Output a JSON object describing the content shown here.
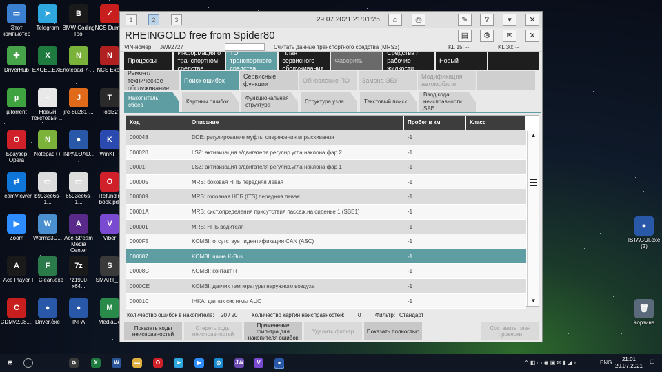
{
  "desktop": {
    "icons": [
      {
        "label": "Этот компьютер",
        "glyph": "▭",
        "color": "#3b7fd0"
      },
      {
        "label": "DriverHub",
        "glyph": "✚",
        "color": "#46a34a"
      },
      {
        "label": "µTorrent",
        "glyph": "µ",
        "color": "#3fa33f"
      },
      {
        "label": "Браузер Opera",
        "glyph": "O",
        "color": "#d0202a"
      },
      {
        "label": "TeamViewer",
        "glyph": "⇄",
        "color": "#0e76d8"
      },
      {
        "label": "Zoom",
        "glyph": "▶",
        "color": "#2d8cff"
      },
      {
        "label": "Ace Player",
        "glyph": "A",
        "color": "#1a1a1a"
      },
      {
        "label": "CDMv2.08....",
        "glyph": "C",
        "color": "#c81e1e"
      },
      {
        "label": "Telegram",
        "glyph": "➤",
        "color": "#2ea6de"
      },
      {
        "label": "EXCEL.EXE",
        "glyph": "X",
        "color": "#1f7a40"
      },
      {
        "label": "Новый текстовый ...",
        "glyph": "≡",
        "color": "#e8e8e8"
      },
      {
        "label": "Notepad++",
        "glyph": "N",
        "color": "#7bb23a"
      },
      {
        "label": "b993ee6s-1...",
        "glyph": "▭",
        "color": "#dcdcdc"
      },
      {
        "label": "Worms3D...",
        "glyph": "W",
        "color": "#4a8fd0"
      },
      {
        "label": "FTClean.exe",
        "glyph": "F",
        "color": "#2a7a4a"
      },
      {
        "label": "Driver.exe",
        "glyph": "●",
        "color": "#2a58a8"
      },
      {
        "label": "BMW Coding Tool",
        "glyph": "B",
        "color": "#1a1a1a"
      },
      {
        "label": "notepad-7-...",
        "glyph": "N",
        "color": "#7bb23a"
      },
      {
        "label": "jre-8u281-...",
        "glyph": "J",
        "color": "#e06a1a"
      },
      {
        "label": "INPALOAD....",
        "glyph": "●",
        "color": "#2a58a8"
      },
      {
        "label": "6593ee6s-1...",
        "glyph": "▭",
        "color": "#dcdcdc"
      },
      {
        "label": "Ace Stream Media Center",
        "glyph": "A",
        "color": "#5a2a8a"
      },
      {
        "label": "7z1900-x64...",
        "glyph": "7z",
        "color": "#1a1a1a"
      },
      {
        "label": "INPA",
        "glyph": "●",
        "color": "#2a58a8"
      },
      {
        "label": "NCS Dumm",
        "glyph": "✓",
        "color": "#c81e1e"
      },
      {
        "label": "NCS Expe",
        "glyph": "N",
        "color": "#b02020"
      },
      {
        "label": "Tool32",
        "glyph": "T",
        "color": "#2a2a2a"
      },
      {
        "label": "WinKFP",
        "glyph": "K",
        "color": "#2a4ab0"
      },
      {
        "label": "Refundin book.pdf",
        "glyph": "O",
        "color": "#d0202a"
      },
      {
        "label": "Viber",
        "glyph": "V",
        "color": "#7a4ad0"
      },
      {
        "label": "SMART_To",
        "glyph": "S",
        "color": "#3a3a3a"
      },
      {
        "label": "MediaGe",
        "glyph": "M",
        "color": "#2a8a4a"
      },
      {
        "label": "ISTAGUI.exe (2)",
        "glyph": "●",
        "color": "#2a58a8"
      },
      {
        "label": "Корзина",
        "glyph": "🗑",
        "color": "#5a6a7a"
      }
    ]
  },
  "app": {
    "topbar": {
      "tabs": [
        "1",
        "2",
        "3"
      ],
      "datetime": "29.07.2021 21:01:25",
      "tools": [
        "home-icon",
        "print-icon",
        "wrench-icon",
        "help-icon",
        "minimize-icon",
        "close-icon"
      ]
    },
    "title": "RHEINGOLD free from Spider80",
    "vin_label": "VIN-номер:",
    "vin_value": "JW92727",
    "vin_status": "Считать данные транспортного средства (MRS3)",
    "kl15": "KL 15:  --",
    "kl30": "KL 30:  --",
    "menu_row1": [
      {
        "label": "Процессы",
        "style": "dark"
      },
      {
        "label": "Информация о транспортном средстве",
        "style": "dark"
      },
      {
        "label": "ТО транспортного средства",
        "style": "teal"
      },
      {
        "label": "План сервисного обслуживания",
        "style": "dark"
      },
      {
        "label": "Фавориты",
        "style": "grey"
      },
      {
        "label": "Средства / рабочие жидкости",
        "style": "dark"
      },
      {
        "label": "Новый",
        "style": "dark"
      }
    ],
    "menu_row2": [
      {
        "label": "Ремонт/ техническое обслуживание",
        "style": "light"
      },
      {
        "label": "Поиск ошибок",
        "style": "teal"
      },
      {
        "label": "Сервисные функции",
        "style": "light"
      },
      {
        "label": "Обновление ПО",
        "style": "lightdis"
      },
      {
        "label": "Замена ЭБУ",
        "style": "lightdis"
      },
      {
        "label": "Модификация автомобиля",
        "style": "lightdis"
      }
    ],
    "subtabs": [
      {
        "label": "Накопитель сбоев",
        "active": true
      },
      {
        "label": "Картины ошибок",
        "active": false
      },
      {
        "label": "Функциональная структура",
        "active": false
      },
      {
        "label": "Структура узла",
        "active": false
      },
      {
        "label": "Текстовый поиск",
        "active": false
      },
      {
        "label": "Ввод кода неисправности SAE",
        "active": false
      }
    ],
    "table": {
      "headers": [
        "Код",
        "Описание",
        "Пробег в км",
        "Класс"
      ],
      "rows": [
        [
          "000048",
          "DDE: регулирование муфты опережения впрыскивания",
          "-1",
          ""
        ],
        [
          "000020",
          "LSZ: активизация э/двигателя регулир.угла наклона фар 2",
          "-1",
          ""
        ],
        [
          "00001F",
          "LSZ: активизация э/двигателя регулир.угла наклона фар 1",
          "-1",
          ""
        ],
        [
          "000005",
          "MRS: боковая НПБ передняя левая",
          "-1",
          ""
        ],
        [
          "000009",
          "MRS: головная НПБ (ITS) передняя левая",
          "-1",
          ""
        ],
        [
          "00001A",
          "MRS: сист.определения присутствия пассаж.на сиденье 1 (SBE1)",
          "-1",
          ""
        ],
        [
          "000001",
          "MRS: НПБ водителя",
          "-1",
          ""
        ],
        [
          "0000F5",
          "KOMBI: отсутствует идентификация CAN (ASC)",
          "-1",
          ""
        ],
        [
          "000087",
          "KOMBI: шина K-Bus",
          "-1",
          ""
        ],
        [
          "00008C",
          "KOMBI: контакт R",
          "-1",
          ""
        ],
        [
          "0000CE",
          "KOMBI: датчик температуры наружного воздуха",
          "-1",
          ""
        ],
        [
          "00001C",
          "IHKA: датчик системы AUC",
          "-1",
          ""
        ]
      ],
      "selected_index": 8
    },
    "status": {
      "errors_label": "Количество ошибок в накопителе:",
      "errors_value": "20 / 20",
      "pictures_label": "Количество картин неисправностей:",
      "pictures_value": "0",
      "filter_label": "Фильтр:",
      "filter_value": "Стандарт"
    },
    "buttons": [
      {
        "label": "Показать коды неисправностей",
        "enabled": true
      },
      {
        "label": "Стереть коды неисправностей",
        "enabled": false
      },
      {
        "label": "Применение фильтра для накопителя ошибок",
        "enabled": true
      },
      {
        "label": "Удалить фильтр",
        "enabled": false
      },
      {
        "label": "Показать полностью",
        "enabled": true
      },
      {
        "label": "Составить план проверки",
        "enabled": false
      }
    ]
  },
  "taskbar": {
    "tray_lang": "ENG",
    "time": "21:01",
    "date": "29.07.2021"
  }
}
